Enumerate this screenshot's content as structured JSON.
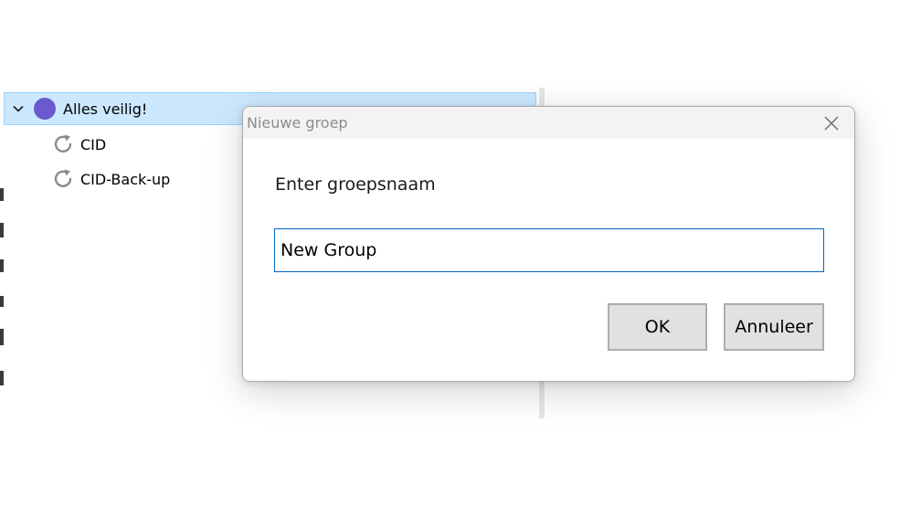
{
  "tree": {
    "root": {
      "label": "Alles veilig!",
      "status_color": "#6a5acd",
      "expanded": true
    },
    "children": [
      {
        "label": "CID",
        "icon": "refresh-icon"
      },
      {
        "label": "CID-Back-up",
        "icon": "refresh-icon"
      }
    ]
  },
  "dialog": {
    "title": "Nieuwe groep",
    "prompt": "Enter groepsnaam",
    "input_value": "New Group",
    "ok_label": "OK",
    "cancel_label": "Annuleer",
    "close_icon": "close-icon"
  },
  "colors": {
    "selection_bg": "#cce8ff",
    "selection_border": "#99d1ff",
    "input_border": "#0067c0",
    "button_bg": "#e1e1e1"
  }
}
